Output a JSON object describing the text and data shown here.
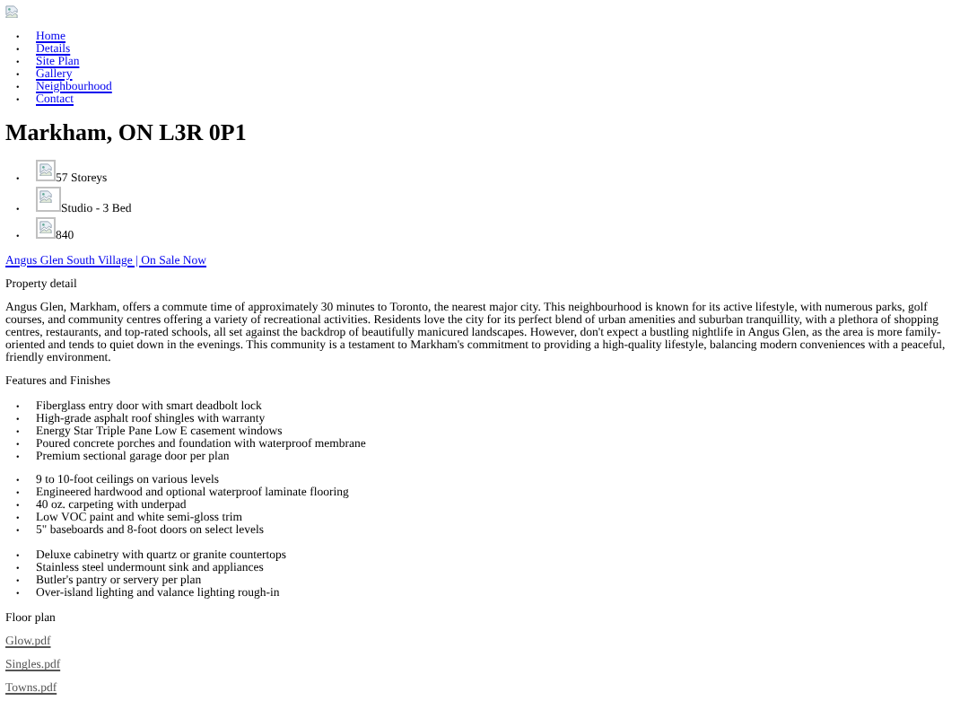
{
  "bullet": "•",
  "nav": [
    "Home",
    "Details",
    "Site Plan",
    "Gallery",
    "Neighbourhood",
    "Contact"
  ],
  "heading": "Markham, ON L3R 0P1",
  "stats": [
    "57 Storeys",
    "Studio - 3 Bed",
    "840"
  ],
  "promo_link": "Angus Glen South Village | On Sale Now ",
  "detail_title": "Property detail",
  "description": "Angus Glen, Markham, offers a commute time of approximately 30 minutes to Toronto, the nearest major city. This neighbourhood is known for its active lifestyle, with numerous parks, golf courses, and community centres offering a variety of recreational activities. Residents love the city for its perfect blend of urban amenities and suburban tranquillity, with a plethora of shopping centres, restaurants, and top-rated schools, all set against the backdrop of beautifully manicured landscapes. However, don't expect a bustling nightlife in Angus Glen, as the area is more family-oriented and tends to quiet down in the evenings. This community is a testament to Markham's commitment to providing a high-quality lifestyle, balancing modern conveniences with a peaceful, friendly environment.",
  "features_title": "Features and Finishes",
  "feature_groups": [
    [
      "Fiberglass entry door with smart deadbolt lock",
      "High-grade asphalt roof shingles with warranty",
      "Energy Star Triple Pane Low E casement windows",
      "Poured concrete porches and foundation with waterproof membrane",
      "Premium sectional garage door per plan"
    ],
    [
      "9 to 10-foot ceilings on various levels",
      "Engineered hardwood and optional waterproof laminate flooring",
      "40 oz. carpeting with underpad",
      "Low VOC paint and white semi-gloss trim",
      "5\" baseboards and 8-foot doors on select levels"
    ],
    [
      "Deluxe cabinetry with quartz or granite countertops",
      "Stainless steel undermount sink and appliances",
      "Butler's pantry or servery per plan",
      "Over-island lighting and valance lighting rough-in"
    ]
  ],
  "floor_plan": {
    "title": "Floor plan",
    "files": [
      "Glow.pdf",
      "Singles.pdf",
      "Towns.pdf"
    ]
  }
}
